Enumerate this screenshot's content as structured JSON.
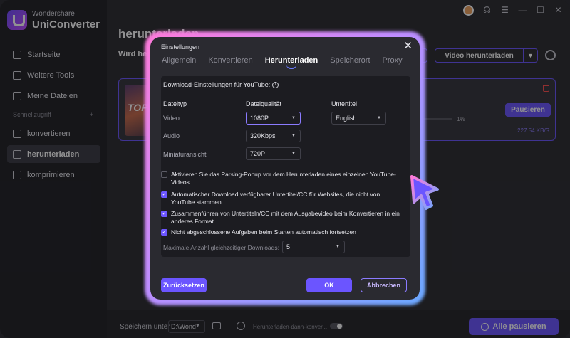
{
  "app": {
    "brand_small": "Wondershare",
    "brand_name": "UniConverter"
  },
  "sidebar": {
    "items": [
      {
        "label": "Startseite",
        "icon": "home-icon"
      },
      {
        "label": "Weitere Tools",
        "icon": "toolbox-icon"
      },
      {
        "label": "Meine Dateien",
        "icon": "file-icon"
      }
    ],
    "section": {
      "label": "Schnellzugriff",
      "add": "+"
    },
    "quick": [
      {
        "label": "konvertieren",
        "icon": "convert-icon"
      },
      {
        "label": "herunterladen",
        "icon": "download-icon",
        "active": true
      },
      {
        "label": "komprimieren",
        "icon": "compress-icon"
      }
    ]
  },
  "main": {
    "title": "herunterladen",
    "subtitle": "Wird he",
    "download_button": "Video herunterladen",
    "task": {
      "thumb_text": "TOP",
      "percent": "1%",
      "pause": "Pausieren",
      "speed": "227.54 KB/S"
    }
  },
  "footer": {
    "save_label": "Speichern unter",
    "path": "D:\\Wond",
    "mode": "Herunterladen-dann-konver...",
    "pause_all": "Alle pausieren"
  },
  "dialog": {
    "title": "Einstellungen",
    "tabs": [
      "Allgemein",
      "Konvertieren",
      "Herunterladen",
      "Speicherort",
      "Proxy"
    ],
    "active_tab": "Herunterladen",
    "yt_settings": "Download-Einstellungen für YouTube:",
    "headers": {
      "type": "Dateityp",
      "quality": "Dateiqualität",
      "subtitle": "Untertitel"
    },
    "rows": {
      "video": {
        "label": "Video",
        "value": "1080P"
      },
      "audio": {
        "label": "Audio",
        "value": "320Kbps"
      },
      "thumb": {
        "label": "Miniaturansicht",
        "value": "720P"
      }
    },
    "subtitle_value": "English",
    "checkboxes": [
      {
        "text": "Aktivieren Sie das Parsing-Popup vor dem Herunterladen eines einzelnen YouTube-Videos",
        "checked": false
      },
      {
        "text": "Automatischer Download verfügbarer Untertitel/CC für Websites, die nicht von YouTube stammen",
        "checked": true
      },
      {
        "text": "Zusammenführen von Untertiteln/CC mit dem Ausgabevideo beim Konvertieren in ein anderes Format",
        "checked": true
      },
      {
        "text": "Nicht abgeschlossene Aufgaben beim Starten automatisch fortsetzen",
        "checked": true
      }
    ],
    "max_label": "Maximale Anzahl gleichzeitiger Downloads:",
    "max_value": "5",
    "reset": "Zurücksetzen",
    "ok": "OK",
    "cancel": "Abbrechen"
  },
  "colors": {
    "accent": "#6b55ff",
    "glow_pink": "#ff7ad9",
    "glow_blue": "#6aa8ff"
  }
}
